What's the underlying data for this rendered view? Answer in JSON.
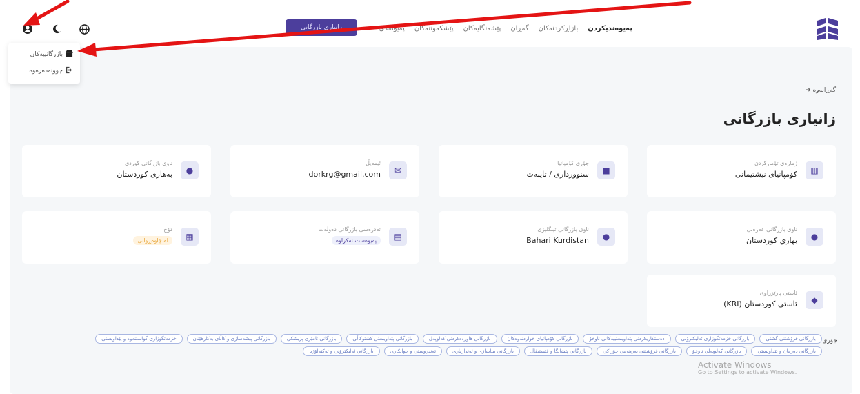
{
  "topbar": {
    "nav": [
      {
        "label": "پەیوەندیکردن",
        "active": true
      },
      {
        "label": "بازاڕکردنەکان",
        "active": false
      },
      {
        "label": "گەڕان",
        "active": false
      },
      {
        "label": "پێشەنگایەکان",
        "active": false
      },
      {
        "label": "پێشکەوتنەکان",
        "active": false
      },
      {
        "label": "پەیوەندی",
        "active": false
      }
    ],
    "action_button": "زانیاری بازرگانی",
    "profile_icon": "user-circle-icon",
    "theme_icon": "moon-icon",
    "language_icon": "globe-icon",
    "accent_color": "#4c3e9c"
  },
  "dropdown": {
    "items": [
      {
        "label": "بازرگانییەکان",
        "icon": "shop-icon"
      },
      {
        "label": "چوونەدەرەوە",
        "icon": "logout-icon"
      }
    ]
  },
  "page": {
    "breadcrumb": "گەڕانەوە",
    "title": "زانیاری بازرگانی"
  },
  "cards": [
    {
      "label": "ژمارەی تۆمارکردن",
      "value": "کۆمپانیای نیشتیمانی",
      "icon": "building-icon"
    },
    {
      "label": "جۆری کۆمپانیا",
      "value": "سنوورداری / تایبەت",
      "icon": "briefcase-icon"
    },
    {
      "label": "ئیمەیڵ",
      "value": "dorkrg@gmail.com",
      "icon": "mail-icon"
    },
    {
      "label": "ناوی بازرگانی کوردی",
      "value": "بەهاری کوردستان",
      "icon": "tag-icon"
    },
    {
      "label": "ناوی بازرگانی عەرەبی",
      "value": "بهاري كوردستان",
      "icon": "tag-icon"
    },
    {
      "label": "ناوی بازرگانی ئینگلیزی",
      "value": "Bahari Kurdistan",
      "icon": "tag-icon"
    },
    {
      "label": "ئەدرەسی بازرگانی دەوڵەت",
      "value": "پەیوەست نەکراوە",
      "icon": "card-icon"
    },
    {
      "label": "دۆخ",
      "value": "لە چاوەڕوانی",
      "icon": "qr-icon"
    },
    {
      "label": "ئاستی پارێزراوی",
      "value": "ئاستی کوردستان (KRI)",
      "icon": "shield-icon"
    }
  ],
  "business_types": {
    "label": "جۆری بازرگانی:",
    "chips": [
      "بازرگانی فرۆشتنی گشتی",
      "بازرگانی خزمەتگوزاری ئەلیکترۆنی",
      "دەستکاریکردنی پێداویستییەکانی ناوخۆ",
      "بازرگانی کۆمپانیای خواردنەوەکان",
      "بازرگانی هاوردەکردنی کەلوپەل",
      "بازرگانی پێداویستی کشتوکاڵی",
      "بازرگانی ئامێری پزیشکی",
      "بازرگانی پیشەسازی و کاڵای بەکارهێنان",
      "خزمەتگوزاری گواستنەوە و پێداویستی",
      "بازرگانی دەرمان و پێداویستی",
      "بازرگانی کەلوپەلی ناوخۆ",
      "بازرگانی فرۆشتنی بەرهەمی خۆراکی",
      "بازرگانی پێشانگا و فێستیڤاڵ",
      "بازرگانی بیناسازی و ئەندازیاری",
      "تەندروستی و جوانکاری",
      "بازرگانی ئەلیکترۆنی و تەکنەلۆژیا"
    ]
  },
  "watermark": {
    "title": "Activate Windows",
    "subtitle": "Go to Settings to activate Windows."
  }
}
